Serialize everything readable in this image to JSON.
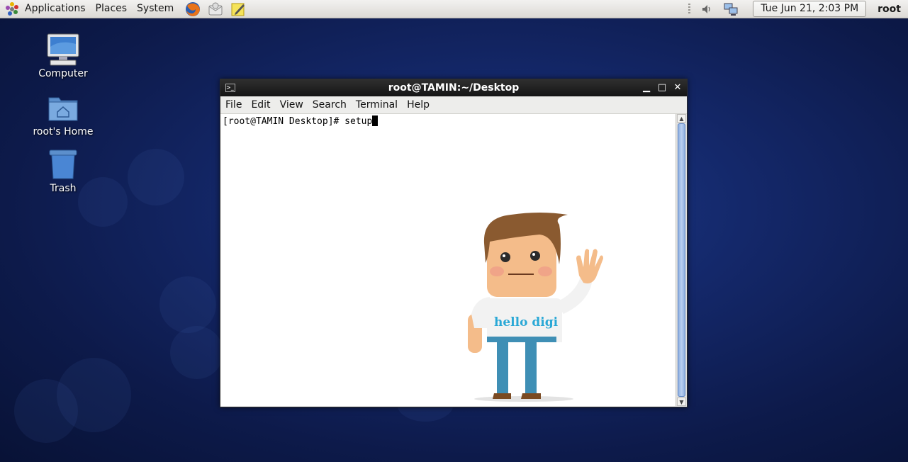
{
  "panel": {
    "menus": [
      "Applications",
      "Places",
      "System"
    ],
    "clock": "Tue Jun 21,  2:03 PM",
    "user": "root"
  },
  "desktop": {
    "icons": [
      {
        "label": "Computer",
        "icon": "computer-icon"
      },
      {
        "label": "root's Home",
        "icon": "home-folder-icon"
      },
      {
        "label": "Trash",
        "icon": "trash-icon"
      }
    ]
  },
  "terminal": {
    "title": "root@TAMIN:~/Desktop",
    "menu": [
      "File",
      "Edit",
      "View",
      "Search",
      "Terminal",
      "Help"
    ],
    "prompt": "[root@TAMIN Desktop]# setup",
    "wallpaper_text": "hello digi"
  },
  "colors": {
    "desktop_bg": "#14286a",
    "titlebar": "#1a1a1a",
    "scroll_thumb": "#8fb0e0",
    "shirt_text": "#2aa8d6"
  }
}
